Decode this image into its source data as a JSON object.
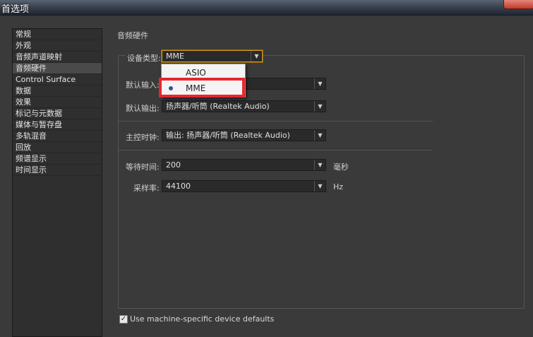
{
  "window": {
    "title": "首选项"
  },
  "sidebar": {
    "items": [
      {
        "label": "常规"
      },
      {
        "label": "外观"
      },
      {
        "label": "音频声道映射"
      },
      {
        "label": "音频硬件"
      },
      {
        "label": "Control Surface"
      },
      {
        "label": "数据"
      },
      {
        "label": "效果"
      },
      {
        "label": "标记与元数据"
      },
      {
        "label": "媒体与暂存盘"
      },
      {
        "label": "多轨混音"
      },
      {
        "label": "回放"
      },
      {
        "label": "频谱显示"
      },
      {
        "label": "时间显示"
      }
    ],
    "selected": "音频硬件"
  },
  "main": {
    "section_title": "音频硬件",
    "device_type": {
      "label": "设备类型:",
      "value": "MME"
    },
    "device_menu": {
      "options": [
        "ASIO",
        "MME"
      ],
      "selected": "MME"
    },
    "default_input": {
      "label": "默认输入:",
      "value": ""
    },
    "default_output": {
      "label": "默认输出:",
      "value": "扬声器/听筒 (Realtek Audio)"
    },
    "master_clock": {
      "label": "主控时钟:",
      "value": "输出: 扬声器/听筒 (Realtek Audio)"
    },
    "latency": {
      "label": "等待时间:",
      "value": "200",
      "unit": "毫秒"
    },
    "sample_rate": {
      "label": "采样率:",
      "value": "44100",
      "unit": "Hz"
    },
    "defaults_checkbox": {
      "label": "Use machine-specific device defaults",
      "checked": true
    }
  },
  "colors": {
    "highlight": "#e8262f",
    "focus": "#d69a1e"
  }
}
